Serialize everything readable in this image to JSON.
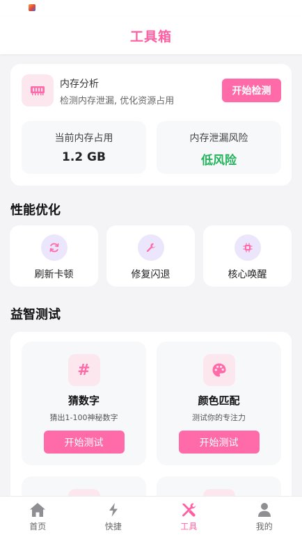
{
  "header": {
    "title": "工具箱"
  },
  "memory": {
    "title": "内存分析",
    "subtitle": "检测内存泄漏, 优化资源占用",
    "button_label": "开始检测",
    "stats": [
      {
        "label": "当前内存占用",
        "value": "1.2 GB"
      },
      {
        "label": "内存泄漏风险",
        "value": "低风险"
      }
    ]
  },
  "performance": {
    "section_title": "性能优化",
    "items": [
      {
        "label": "刷新卡顿",
        "icon": "refresh-icon"
      },
      {
        "label": "修复闪退",
        "icon": "wrench-icon"
      },
      {
        "label": "核心唤醒",
        "icon": "chip-icon"
      }
    ]
  },
  "puzzles": {
    "section_title": "益智测试",
    "games": [
      {
        "title": "猜数字",
        "desc": "猜出1-100神秘数字",
        "button_label": "开始测试",
        "icon": "hash-icon"
      },
      {
        "title": "颜色匹配",
        "desc": "测试你的专注力",
        "button_label": "开始测试",
        "icon": "palette-icon"
      }
    ]
  },
  "tabbar": {
    "tabs": [
      {
        "label": "首页",
        "icon": "home-icon"
      },
      {
        "label": "快捷",
        "icon": "bolt-icon"
      },
      {
        "label": "工具",
        "icon": "tools-icon",
        "active": true
      },
      {
        "label": "我的",
        "icon": "user-icon"
      }
    ]
  },
  "colors": {
    "accent": "#ff5fa2",
    "button": "#ff6aa8",
    "success": "#22b45a",
    "icon_purple_bg": "#ebe6fb",
    "icon_pink_bg": "#fde7ef"
  }
}
